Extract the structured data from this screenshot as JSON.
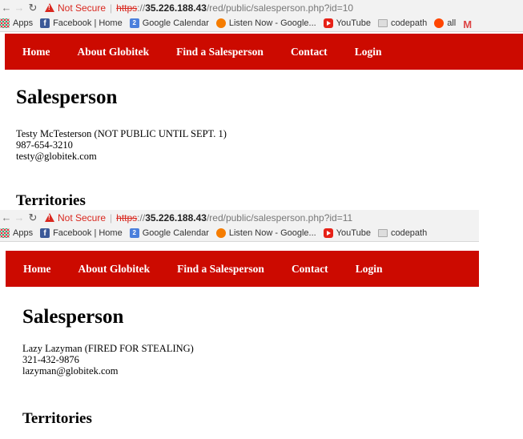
{
  "screenshot_top": {
    "browser": {
      "not_secure_label": "Not Secure",
      "url_scheme": "https",
      "url_rest_sep": "://",
      "url_host": "35.226.188.43",
      "url_path": "/red/public/salesperson.php?id=10"
    },
    "bookmarks": [
      {
        "label": "Apps",
        "icon": "apps-grid-icon"
      },
      {
        "label": "Facebook | Home",
        "icon": "facebook-icon"
      },
      {
        "label": "Google Calendar",
        "icon": "calendar-icon"
      },
      {
        "label": "Listen Now - Google...",
        "icon": "google-play-music-icon"
      },
      {
        "label": "YouTube",
        "icon": "youtube-icon"
      },
      {
        "label": "codepath",
        "icon": "folder-icon"
      },
      {
        "label": "all",
        "icon": "reddit-icon"
      },
      {
        "label": "",
        "icon": "gmail-icon"
      }
    ],
    "nav": [
      "Home",
      "About Globitek",
      "Find a Salesperson",
      "Contact",
      "Login"
    ],
    "title": "Salesperson",
    "name_line": "Testy McTesterson (NOT PUBLIC UNTIL SEPT. 1)",
    "phone": "987-654-3210",
    "email": "testy@globitek.com",
    "section": "Territories"
  },
  "screenshot_bottom": {
    "browser": {
      "not_secure_label": "Not Secure",
      "url_scheme": "https",
      "url_rest_sep": "://",
      "url_host": "35.226.188.43",
      "url_path": "/red/public/salesperson.php?id=11"
    },
    "bookmarks": [
      {
        "label": "Apps",
        "icon": "apps-grid-icon"
      },
      {
        "label": "Facebook | Home",
        "icon": "facebook-icon"
      },
      {
        "label": "Google Calendar",
        "icon": "calendar-icon"
      },
      {
        "label": "Listen Now - Google...",
        "icon": "google-play-music-icon"
      },
      {
        "label": "YouTube",
        "icon": "youtube-icon"
      },
      {
        "label": "codepath",
        "icon": "folder-icon"
      }
    ],
    "nav": [
      "Home",
      "About Globitek",
      "Find a Salesperson",
      "Contact",
      "Login"
    ],
    "title": "Salesperson",
    "name_line": "Lazy Lazyman (FIRED FOR STEALING)",
    "phone": "321-432-9876",
    "email": "lazyman@globitek.com",
    "section": "Territories"
  },
  "colors": {
    "nav_bar": "#cc0a00",
    "not_secure": "#d9281f",
    "chrome_bar": "#f2f2f2"
  }
}
